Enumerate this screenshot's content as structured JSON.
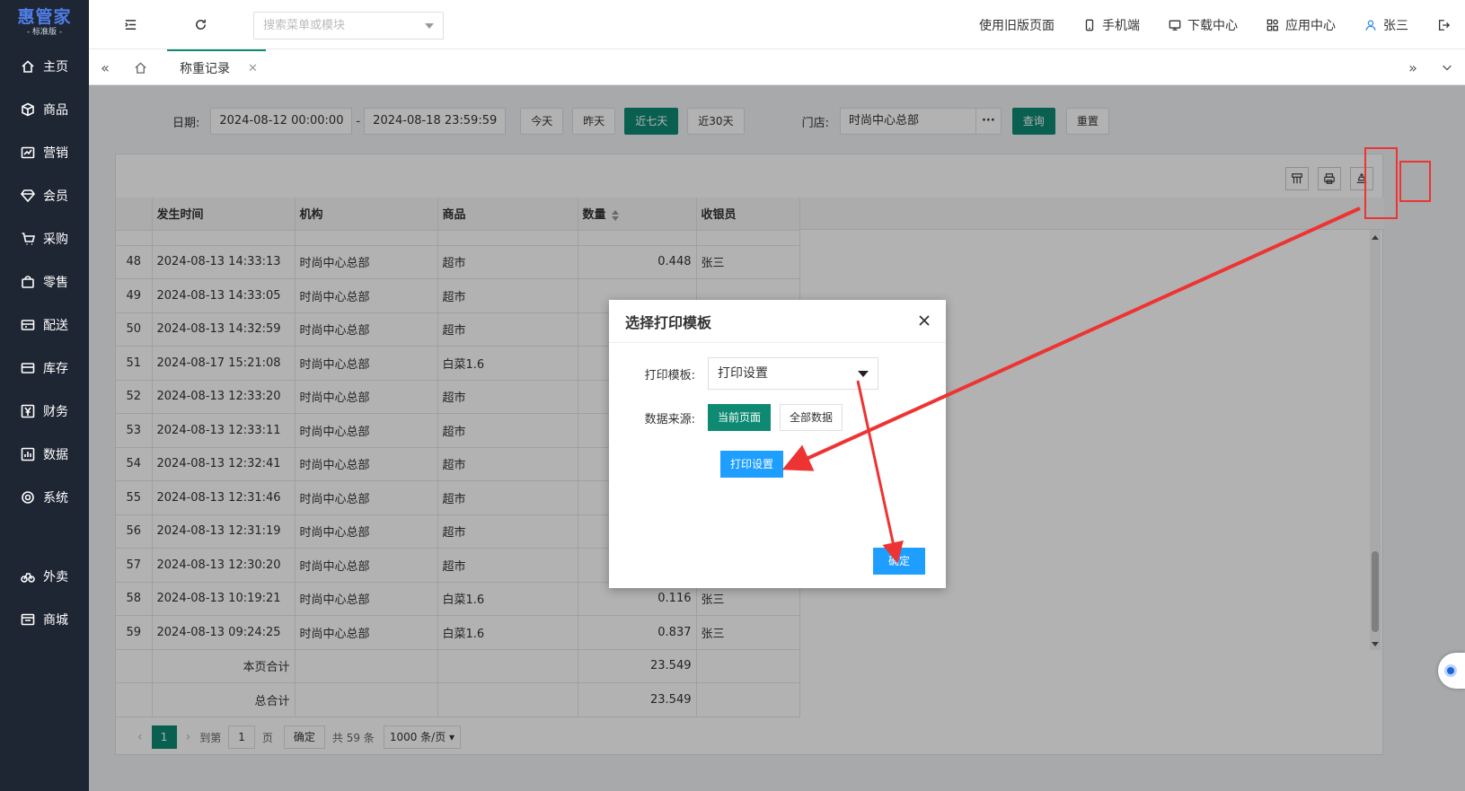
{
  "sidebar": {
    "logo": "惠管家",
    "logo_sub": "- 标准版 -",
    "items": [
      {
        "label": "主页",
        "icon": "home-icon"
      },
      {
        "label": "商品",
        "icon": "box-icon"
      },
      {
        "label": "营销",
        "icon": "chart-icon"
      },
      {
        "label": "会员",
        "icon": "diamond-icon"
      },
      {
        "label": "采购",
        "icon": "cart-icon"
      },
      {
        "label": "零售",
        "icon": "bag-icon"
      },
      {
        "label": "配送",
        "icon": "truck-icon"
      },
      {
        "label": "库存",
        "icon": "inventory-icon"
      },
      {
        "label": "财务",
        "icon": "yen-icon"
      },
      {
        "label": "数据",
        "icon": "bar-chart-icon"
      },
      {
        "label": "系统",
        "icon": "gear-icon"
      }
    ],
    "extra_items": [
      {
        "label": "外卖",
        "icon": "bike-icon"
      },
      {
        "label": "商城",
        "icon": "store-icon"
      }
    ]
  },
  "topbar": {
    "search_placeholder": "搜索菜单或模块",
    "links": [
      "使用旧版页面",
      "手机端",
      "下载中心",
      "应用中心"
    ],
    "user": "张三"
  },
  "tabs": [
    {
      "label": "称重记录"
    }
  ],
  "filter": {
    "date_label": "日期:",
    "date_start": "2024-08-12 00:00:00",
    "date_sep": "-",
    "date_end": "2024-08-18 23:59:59",
    "quick": [
      "今天",
      "昨天",
      "近七天",
      "近30天"
    ],
    "store_label": "门店:",
    "store_value": "时尚中心总部",
    "more": "···",
    "query": "查询",
    "reset": "重置"
  },
  "table": {
    "columns": [
      "",
      "发生时间",
      "机构",
      "商品",
      "数量",
      "收银员"
    ],
    "rows": [
      [
        "48",
        "2024-08-13 14:33:13",
        "时尚中心总部",
        "超市",
        "0.448",
        "张三"
      ],
      [
        "49",
        "2024-08-13 14:33:05",
        "时尚中心总部",
        "超市",
        "",
        ""
      ],
      [
        "50",
        "2024-08-13 14:32:59",
        "时尚中心总部",
        "超市",
        "",
        ""
      ],
      [
        "51",
        "2024-08-17 15:21:08",
        "时尚中心总部",
        "白菜1.6",
        "",
        ""
      ],
      [
        "52",
        "2024-08-13 12:33:20",
        "时尚中心总部",
        "超市",
        "",
        ""
      ],
      [
        "53",
        "2024-08-13 12:33:11",
        "时尚中心总部",
        "超市",
        "",
        ""
      ],
      [
        "54",
        "2024-08-13 12:32:41",
        "时尚中心总部",
        "超市",
        "",
        ""
      ],
      [
        "55",
        "2024-08-13 12:31:46",
        "时尚中心总部",
        "超市",
        "",
        ""
      ],
      [
        "56",
        "2024-08-13 12:31:19",
        "时尚中心总部",
        "超市",
        "",
        ""
      ],
      [
        "57",
        "2024-08-13 12:30:20",
        "时尚中心总部",
        "超市",
        "",
        ""
      ],
      [
        "58",
        "2024-08-13 10:19:21",
        "时尚中心总部",
        "白菜1.6",
        "0.116",
        "张三"
      ],
      [
        "59",
        "2024-08-13 09:24:25",
        "时尚中心总部",
        "白菜1.6",
        "0.837",
        "张三"
      ]
    ],
    "page_total_label": "本页合计",
    "page_total": "23.549",
    "grand_total_label": "总合计",
    "grand_total": "23.549"
  },
  "pager": {
    "current": "1",
    "goto_label": "到第",
    "goto_value": "1",
    "page_unit": "页",
    "confirm": "确定",
    "total": "共 59 条",
    "page_size": "1000 条/页"
  },
  "dialog": {
    "title": "选择打印模板",
    "template_label": "打印模板:",
    "template_value": "打印设置",
    "source_label": "数据来源:",
    "source_current": "当前页面",
    "source_all": "全部数据",
    "print_settings": "打印设置",
    "ok": "确定"
  },
  "colors": {
    "sidebar_bg": "#1f2633",
    "primary_green": "#0e8a73",
    "primary_blue": "#1e9fff",
    "annotation_red": "#e33333"
  }
}
